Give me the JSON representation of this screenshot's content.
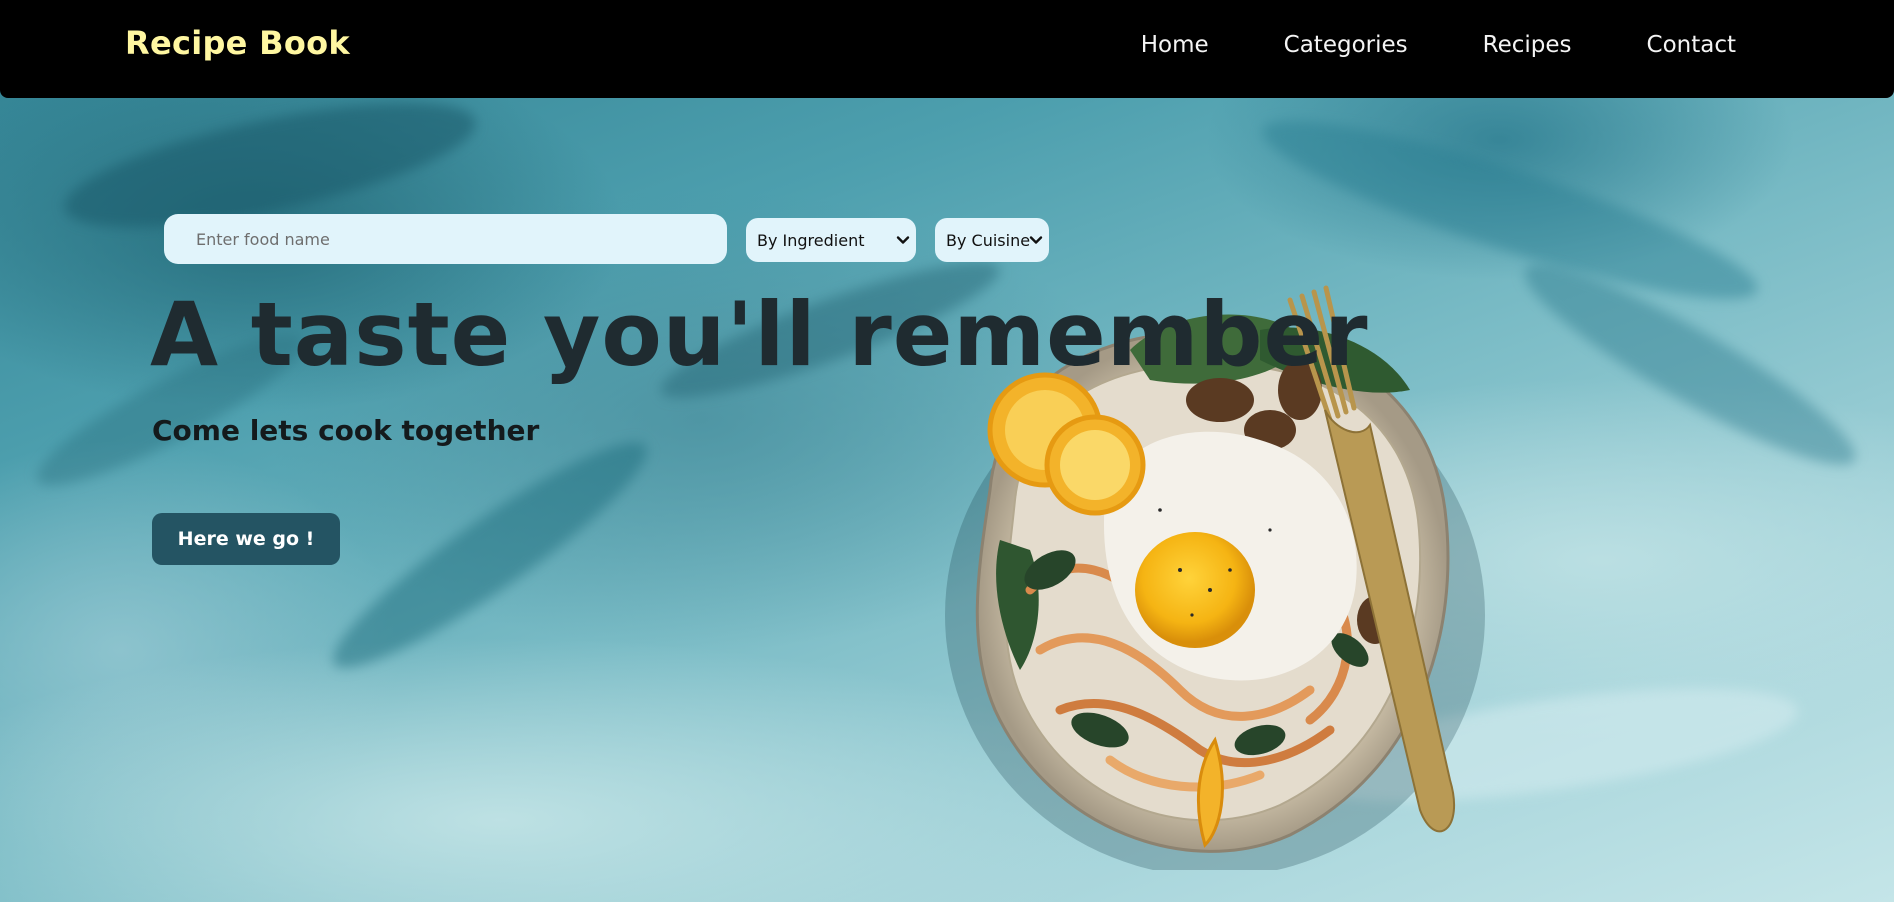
{
  "header": {
    "logo": "Recipe Book",
    "nav": [
      {
        "label": "Home"
      },
      {
        "label": "Categories"
      },
      {
        "label": "Recipes"
      },
      {
        "label": "Contact"
      }
    ]
  },
  "search": {
    "placeholder": "Enter food name",
    "filters": [
      {
        "label": "By Ingredient"
      },
      {
        "label": "By Cuisine"
      }
    ]
  },
  "hero": {
    "title": "A taste you'll remember",
    "subtitle": "Come lets cook together",
    "cta_label": "Here we go !"
  },
  "colors": {
    "header_bg": "#000000",
    "logo": "#fff7a1",
    "cta_bg": "#245463",
    "input_bg": "#e1f4fb"
  },
  "icons": {
    "select_chevron": "chevron-down-icon",
    "hero_image": "food-bowl-image"
  }
}
